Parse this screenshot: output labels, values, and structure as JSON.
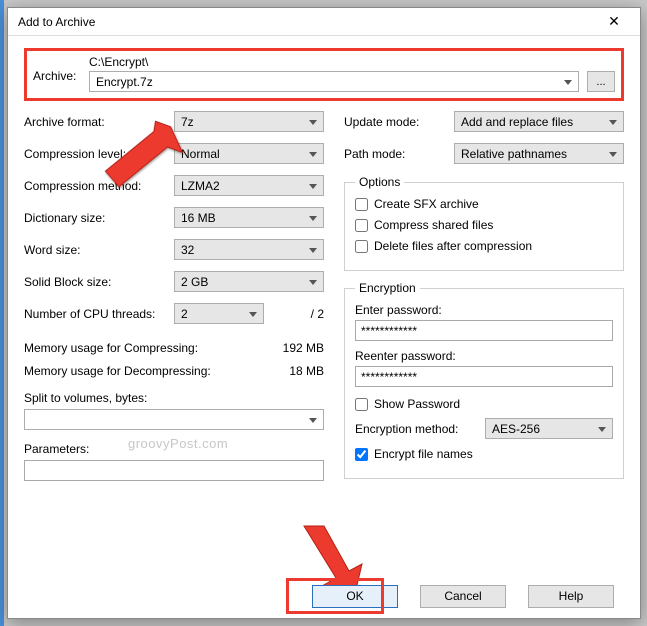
{
  "title": "Add to Archive",
  "archive": {
    "label": "Archive:",
    "path": "C:\\Encrypt\\",
    "filename": "Encrypt.7z",
    "browse": "..."
  },
  "left": {
    "format_label": "Archive format:",
    "format_value": "7z",
    "compression_level_label": "Compression level:",
    "compression_level_value": "Normal",
    "compression_method_label": "Compression method:",
    "compression_method_value": "LZMA2",
    "dictionary_label": "Dictionary size:",
    "dictionary_value": "16 MB",
    "word_label": "Word size:",
    "word_value": "32",
    "block_label": "Solid Block size:",
    "block_value": "2 GB",
    "threads_label": "Number of CPU threads:",
    "threads_value": "2",
    "threads_total": "/ 2",
    "mem_comp_label": "Memory usage for Compressing:",
    "mem_comp_value": "192 MB",
    "mem_decomp_label": "Memory usage for Decompressing:",
    "mem_decomp_value": "18 MB",
    "split_label": "Split to volumes, bytes:",
    "split_value": "",
    "params_label": "Parameters:",
    "params_value": ""
  },
  "right": {
    "update_label": "Update mode:",
    "update_value": "Add and replace files",
    "path_label": "Path mode:",
    "path_value": "Relative pathnames",
    "options_legend": "Options",
    "opt_sfx": "Create SFX archive",
    "opt_shared": "Compress shared files",
    "opt_delete": "Delete files after compression",
    "enc_legend": "Encryption",
    "enter_pw_label": "Enter password:",
    "reenter_pw_label": "Reenter password:",
    "pw_mask": "************",
    "show_pw": "Show Password",
    "enc_method_label": "Encryption method:",
    "enc_method_value": "AES-256",
    "enc_names": "Encrypt file names"
  },
  "buttons": {
    "ok": "OK",
    "cancel": "Cancel",
    "help": "Help"
  },
  "watermark": "groovyPost.com"
}
